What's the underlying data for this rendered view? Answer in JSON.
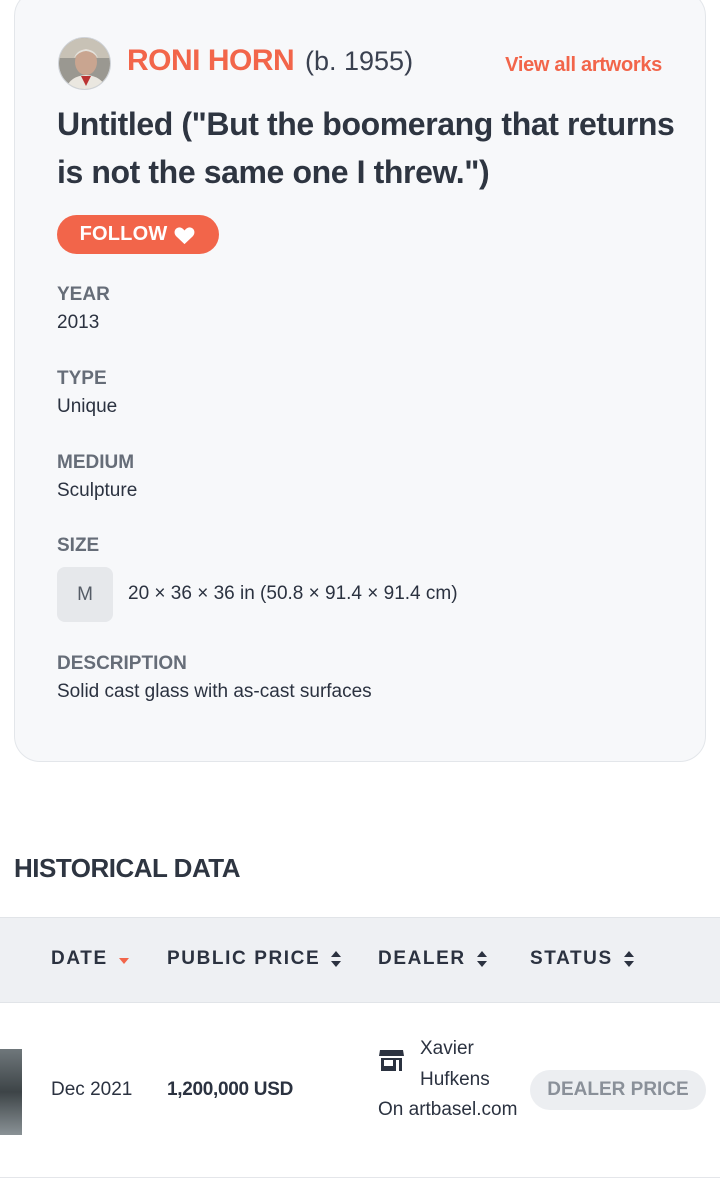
{
  "artist": {
    "name": "RONI HORN",
    "birth": "(b. 1955)",
    "view_all_label": "View all artworks"
  },
  "artwork": {
    "title": "Untitled (\"But the boomerang that returns is not the same one I threw.\")",
    "follow_label": "FOLLOW",
    "fields": {
      "year_label": "YEAR",
      "year_value": "2013",
      "type_label": "TYPE",
      "type_value": "Unique",
      "medium_label": "MEDIUM",
      "medium_value": "Sculpture",
      "size_label": "SIZE",
      "size_badge": "M",
      "size_value": "20 × 36 × 36 in (50.8 × 91.4 × 91.4 cm)",
      "description_label": "DESCRIPTION",
      "description_value": "Solid cast glass with as-cast surfaces"
    }
  },
  "history": {
    "section_title": "HISTORICAL DATA",
    "columns": [
      "DATE",
      "PUBLIC PRICE",
      "DEALER",
      "STATUS"
    ],
    "rows": [
      {
        "date": "Dec 2021",
        "price": "1,200,000 USD",
        "dealer": "Xavier Hufkens",
        "source": "On artbasel.com",
        "status": "DEALER PRICE"
      }
    ]
  },
  "colors": {
    "accent": "#f2654a",
    "card_bg": "#f7f8fa",
    "text": "#2b3240"
  }
}
